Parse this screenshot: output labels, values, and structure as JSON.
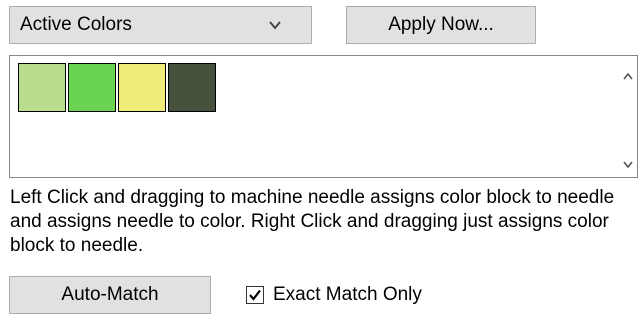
{
  "dropdown": {
    "selected": "Active Colors",
    "arrow_icon": "chevron-down-icon"
  },
  "apply_button": {
    "label": "Apply Now..."
  },
  "color_list": {
    "swatches": [
      {
        "name": "swatch-1",
        "color": "#b9dd8c"
      },
      {
        "name": "swatch-2",
        "color": "#6ad452"
      },
      {
        "name": "swatch-3",
        "color": "#f0ec7a"
      },
      {
        "name": "swatch-4",
        "color": "#45513d"
      }
    ],
    "scroll_up_icon": "chevron-up-icon",
    "scroll_down_icon": "chevron-down-icon"
  },
  "help_text": "Left Click and dragging to machine needle assigns color block to needle and assigns needle to color.  Right Click and dragging just assigns color block to needle.",
  "auto_match_button": {
    "label": "Auto-Match"
  },
  "exact_match": {
    "label": "Exact Match Only",
    "checked": true
  }
}
